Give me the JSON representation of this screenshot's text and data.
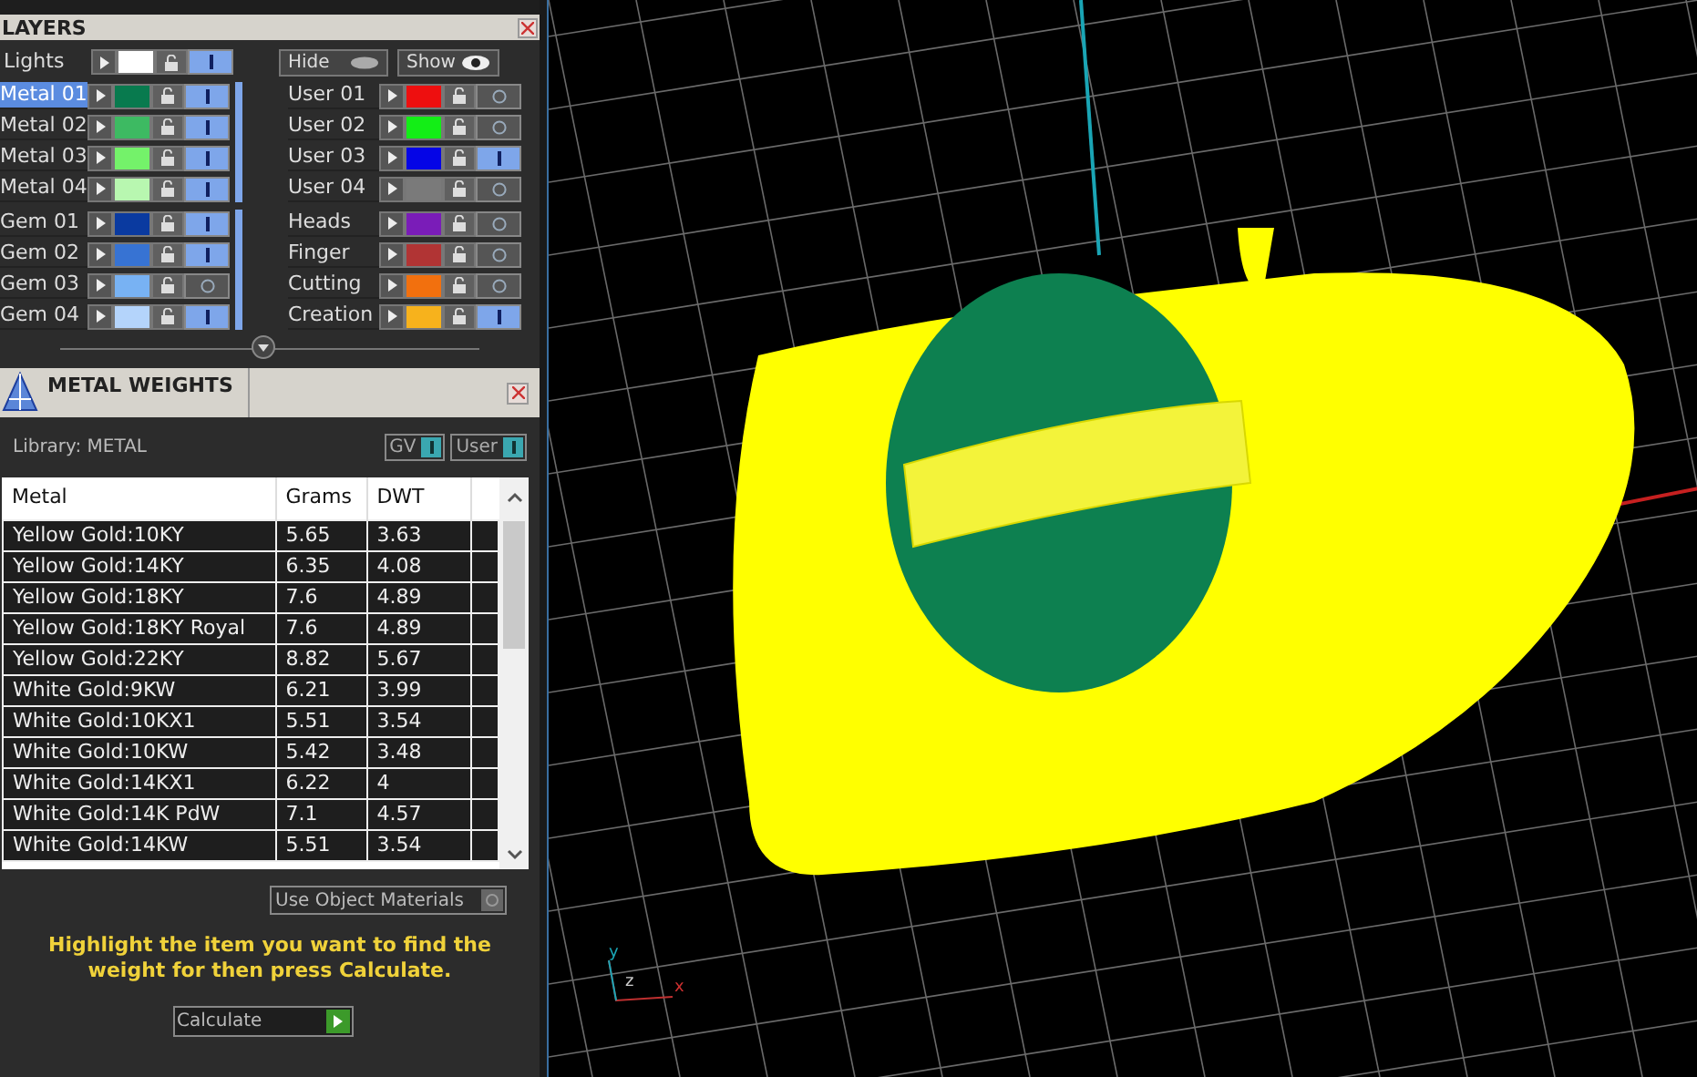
{
  "layers_panel": {
    "title": "LAYERS",
    "lights": {
      "label": "Lights",
      "color": "#ffffff",
      "visible": true
    },
    "hide_button": "Hide",
    "show_button": "Show",
    "groups": [
      {
        "items": [
          {
            "label": "Metal 01",
            "selected": true,
            "color": "#087a4e",
            "visible": true
          },
          {
            "label": "Metal 02",
            "selected": false,
            "color": "#3dba62",
            "visible": true
          },
          {
            "label": "Metal 03",
            "selected": false,
            "color": "#74f26a",
            "visible": true
          },
          {
            "label": "Metal 04",
            "selected": false,
            "color": "#b8f7b0",
            "visible": true
          }
        ]
      },
      {
        "items": [
          {
            "label": "User 01",
            "selected": false,
            "color": "#ee0f0f",
            "visible": false
          },
          {
            "label": "User 02",
            "selected": false,
            "color": "#13ee16",
            "visible": false
          },
          {
            "label": "User 03",
            "selected": false,
            "color": "#0505e6",
            "visible": true
          },
          {
            "label": "User 04",
            "selected": false,
            "color": "#7a7a7a",
            "visible": false
          }
        ]
      },
      {
        "items": [
          {
            "label": "Gem 01",
            "selected": false,
            "color": "#0a3aa0",
            "visible": true
          },
          {
            "label": "Gem 02",
            "selected": false,
            "color": "#3773d3",
            "visible": true
          },
          {
            "label": "Gem 03",
            "selected": false,
            "color": "#78b2f3",
            "visible": false
          },
          {
            "label": "Gem 04",
            "selected": false,
            "color": "#b4d4fb",
            "visible": true
          }
        ]
      },
      {
        "items": [
          {
            "label": "Heads",
            "selected": false,
            "color": "#7a1cb8",
            "visible": false
          },
          {
            "label": "Finger",
            "selected": false,
            "color": "#b13434",
            "visible": false
          },
          {
            "label": "Cutting",
            "selected": false,
            "color": "#f2700e",
            "visible": false
          },
          {
            "label": "Creation",
            "selected": false,
            "color": "#f7b21c",
            "visible": true
          }
        ]
      }
    ]
  },
  "metal_weights_panel": {
    "title": "METAL WEIGHTS",
    "library": "Library: METAL",
    "toggles": [
      {
        "label": "GV",
        "on": true
      },
      {
        "label": "User",
        "on": true
      }
    ],
    "table": {
      "columns": [
        "Metal",
        "Grams",
        "DWT"
      ],
      "rows": [
        [
          "Yellow Gold:10KY",
          "5.65",
          "3.63"
        ],
        [
          "Yellow Gold:14KY",
          "6.35",
          "4.08"
        ],
        [
          "Yellow Gold:18KY",
          "7.6",
          "4.89"
        ],
        [
          "Yellow Gold:18KY Royal",
          "7.6",
          "4.89"
        ],
        [
          "Yellow Gold:22KY",
          "8.82",
          "5.67"
        ],
        [
          "White Gold:9KW",
          "6.21",
          "3.99"
        ],
        [
          "White Gold:10KX1",
          "5.51",
          "3.54"
        ],
        [
          "White Gold:10KW",
          "5.42",
          "3.48"
        ],
        [
          "White Gold:14KX1",
          "6.22",
          "4"
        ],
        [
          "White Gold:14K PdW",
          "7.1",
          "4.57"
        ],
        [
          "White Gold:14KW",
          "5.51",
          "3.54"
        ]
      ]
    },
    "use_object_materials": {
      "label": "Use Object Materials",
      "checked": false
    },
    "instructions": "Highlight the item you want to find the weight for then press Calculate.",
    "calculate_button": "Calculate"
  },
  "viewport": {
    "axes": [
      "y",
      "z",
      "x"
    ]
  }
}
